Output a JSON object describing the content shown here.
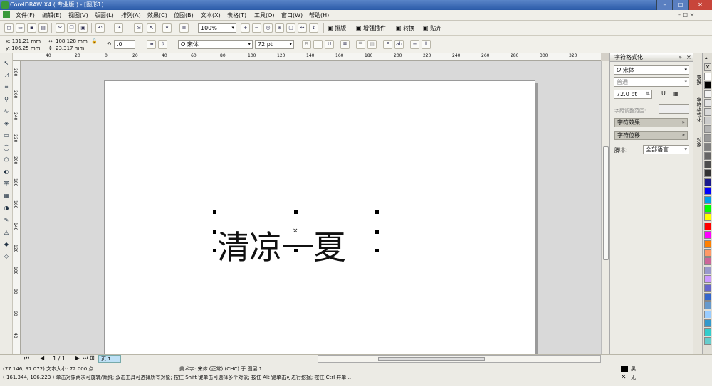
{
  "window": {
    "title": "CorelDRAW X4 ( 专业版 ) - [图形1]",
    "minimize": "–",
    "maximize": "□",
    "close": "✕"
  },
  "menu": {
    "items": [
      "文件(F)",
      "编辑(E)",
      "视图(V)",
      "版面(L)",
      "排列(A)",
      "效果(C)",
      "位图(B)",
      "文本(X)",
      "表格(T)",
      "工具(O)",
      "窗口(W)",
      "帮助(H)"
    ],
    "doc_controls": "– □ ×"
  },
  "toolbar": {
    "zoom": "100%",
    "labels": [
      "排版",
      "增强插件",
      "转换",
      "贴齐"
    ]
  },
  "props": {
    "x": "x: 131.21 mm",
    "y": "y: 106.25 mm",
    "w": "108.128 mm",
    "h": "23.317 mm",
    "angle": ".0",
    "font": "宋体",
    "size": "72 pt"
  },
  "ruler": {
    "h_ticks": [
      "40",
      "20",
      "0",
      "20",
      "40",
      "60",
      "80",
      "100",
      "120",
      "140",
      "160",
      "180",
      "200",
      "220",
      "240",
      "260",
      "280",
      "300",
      "320"
    ],
    "v_ticks": [
      "280",
      "260",
      "240",
      "220",
      "200",
      "180",
      "160",
      "140",
      "120",
      "100",
      "80",
      "60",
      "40"
    ]
  },
  "canvas": {
    "art_text": "清凉一夏"
  },
  "docker": {
    "title": "字符格式化",
    "font": "宋体",
    "style": "普通",
    "size": "72.0 pt",
    "kerning_label": "字距调整范围:",
    "section1": "字符效果",
    "section2": "字符位移",
    "script_label": "脚本:",
    "script_value": "全部语言"
  },
  "docker_tabs": [
    "变换",
    "字符格式化",
    "对象"
  ],
  "palette_colors": [
    "#ffffff",
    "#000000",
    "#f2f2f2",
    "#e5e5e5",
    "#d9d9d9",
    "#cccccc",
    "#b3b3b3",
    "#999999",
    "#808080",
    "#666666",
    "#4d4d4d",
    "#333333",
    "#1a1a8c",
    "#0000ff",
    "#00a0e9",
    "#00ff00",
    "#ffff00",
    "#ff0000",
    "#ff00ff",
    "#ff8000",
    "#ff9966",
    "#cc6699",
    "#9999cc",
    "#cc99ff",
    "#6666cc",
    "#3366cc",
    "#6699cc",
    "#99ccff",
    "#3399cc",
    "#33cccc",
    "#66cccc"
  ],
  "bottom": {
    "page_count": "1 / 1",
    "page_tab": "页 1"
  },
  "status": {
    "line1_left": "(77.146, 97.072)  文本大小: 72.000 点",
    "line1_right": "美术字: 宋体 (正常) (CHC) 于 图层 1",
    "line2": "( 161.344, 106.223 )    单击对象两次可旋转/倾斜; 双击工具可选择所有对象; 按住 Shift 键单击可选择多个对象; 按住 Alt 键单击可进行挖掘; 按住 Ctrl 并单...",
    "fill_label": "黑",
    "outline_label": "无"
  }
}
